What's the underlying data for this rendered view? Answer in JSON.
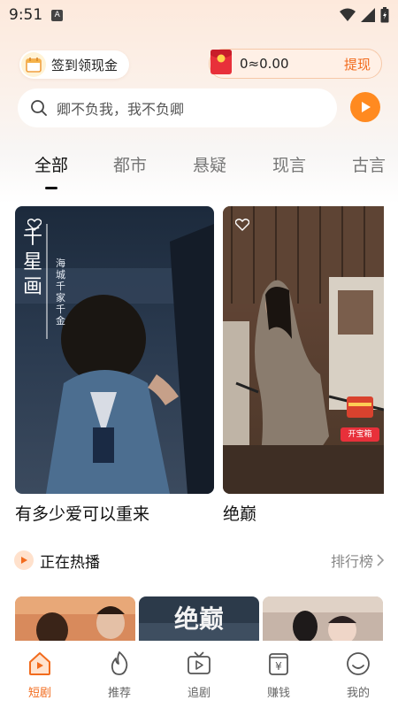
{
  "status": {
    "time": "9:51",
    "notif_badge": "A"
  },
  "header": {
    "checkin_label": "签到领现金",
    "wallet_balance": "0≈0.00",
    "wallet_withdraw": "提现"
  },
  "search": {
    "query": "卿不负我，我不负卿"
  },
  "tabs": [
    {
      "label": "全部",
      "active": true
    },
    {
      "label": "都市"
    },
    {
      "label": "悬疑"
    },
    {
      "label": "现言"
    },
    {
      "label": "古言"
    }
  ],
  "cards": [
    {
      "title": "有多少爱可以重来",
      "poster_text_1": "千星画",
      "poster_text_2": "海城千家千金"
    },
    {
      "title": "绝巅",
      "badge": "开宝箱"
    }
  ],
  "section": {
    "title": "正在热播",
    "more": "排行榜"
  },
  "thumbs": [
    {
      "overlay": ""
    },
    {
      "overlay": "绝巅"
    },
    {
      "overlay": ""
    }
  ],
  "nav": [
    {
      "label": "短剧",
      "icon": "home-icon",
      "active": true
    },
    {
      "label": "推荐",
      "icon": "flame-icon"
    },
    {
      "label": "追剧",
      "icon": "tv-icon"
    },
    {
      "label": "赚钱",
      "icon": "money-icon"
    },
    {
      "label": "我的",
      "icon": "profile-icon"
    }
  ],
  "colors": {
    "accent": "#f26b1d",
    "play": "#ff8a20"
  }
}
